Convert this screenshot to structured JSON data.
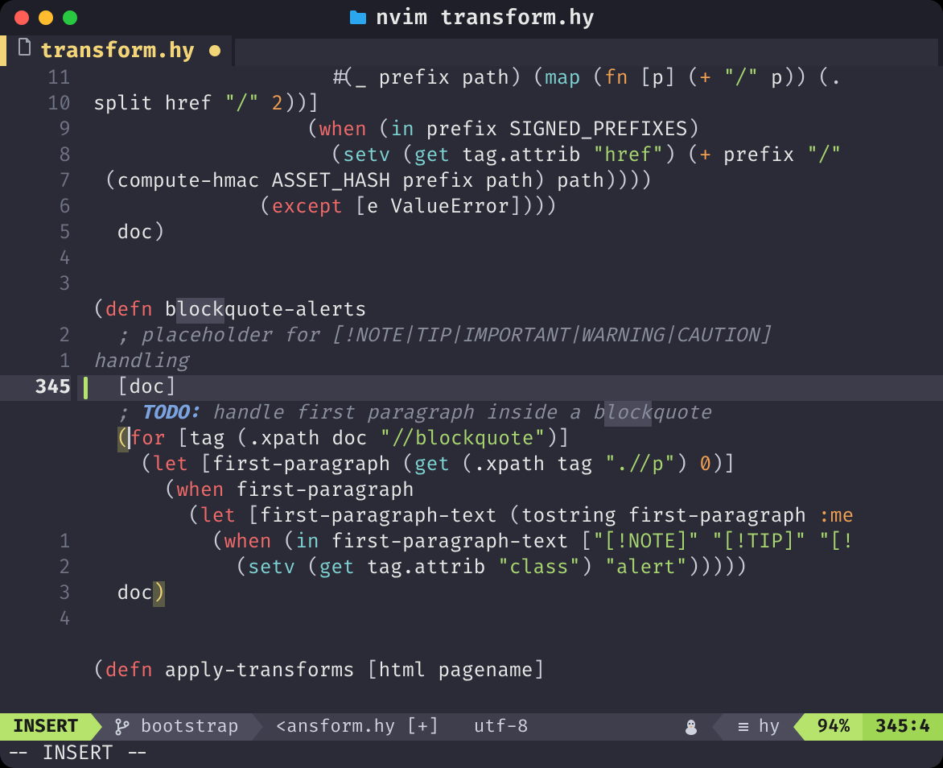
{
  "window": {
    "title": "nvim transform.hy"
  },
  "tab": {
    "filename": "transform.hy",
    "modified": true
  },
  "gutter": {
    "relative_numbers": [
      "11",
      "10",
      "9",
      "8",
      "7",
      "6",
      "5",
      "4",
      "3",
      "",
      "2",
      "1",
      "345",
      "",
      "",
      "",
      "",
      "",
      "1",
      "2",
      "3",
      "4"
    ],
    "current_line_index": 12
  },
  "code": {
    "lines": [
      [
        {
          "indent": "                    "
        },
        {
          "c": "pn",
          "t": "#("
        },
        {
          "c": "id",
          "t": "_ prefix path"
        },
        {
          "c": "pn",
          "t": ") ("
        },
        {
          "c": "fn",
          "t": "map"
        },
        {
          "c": "pn",
          "t": " ("
        },
        {
          "c": "op",
          "t": "fn"
        },
        {
          "c": "pn",
          "t": " ["
        },
        {
          "c": "id",
          "t": "p"
        },
        {
          "c": "pn",
          "t": "] ("
        },
        {
          "c": "op",
          "t": "+"
        },
        {
          "c": "pn",
          "t": " "
        },
        {
          "c": "st",
          "t": "\"/\""
        },
        {
          "c": "pn",
          "t": " "
        },
        {
          "c": "id",
          "t": "p"
        },
        {
          "c": "pn",
          "t": ")) (."
        }
      ],
      [
        {
          "c": "id",
          "t": "split href "
        },
        {
          "c": "st",
          "t": "\"/\""
        },
        {
          "c": "pn",
          "t": " "
        },
        {
          "c": "nu",
          "t": "2"
        },
        {
          "c": "pn",
          "t": "))]"
        }
      ],
      [
        {
          "indent": "                  "
        },
        {
          "c": "pn",
          "t": "("
        },
        {
          "c": "kw",
          "t": "when"
        },
        {
          "c": "pn",
          "t": " ("
        },
        {
          "c": "fn",
          "t": "in"
        },
        {
          "c": "pn",
          "t": " "
        },
        {
          "c": "id",
          "t": "prefix SIGNED_PREFIXES"
        },
        {
          "c": "pn",
          "t": ")"
        }
      ],
      [
        {
          "indent": "                    "
        },
        {
          "c": "pn",
          "t": "("
        },
        {
          "c": "fn",
          "t": "setv"
        },
        {
          "c": "pn",
          "t": " ("
        },
        {
          "c": "fn",
          "t": "get"
        },
        {
          "c": "pn",
          "t": " "
        },
        {
          "c": "id",
          "t": "tag.attrib "
        },
        {
          "c": "st",
          "t": "\"href\""
        },
        {
          "c": "pn",
          "t": ") ("
        },
        {
          "c": "op",
          "t": "+"
        },
        {
          "c": "pn",
          "t": " "
        },
        {
          "c": "id",
          "t": "prefix "
        },
        {
          "c": "st",
          "t": "\"/\""
        }
      ],
      [
        {
          "c": "pn",
          "t": " ("
        },
        {
          "c": "id",
          "t": "compute-hmac ASSET_HASH prefix path"
        },
        {
          "c": "pn",
          "t": ") "
        },
        {
          "c": "id",
          "t": "path"
        },
        {
          "c": "pn",
          "t": "))))"
        }
      ],
      [
        {
          "indent": "              "
        },
        {
          "c": "pn",
          "t": "("
        },
        {
          "c": "kw",
          "t": "except"
        },
        {
          "c": "pn",
          "t": " ["
        },
        {
          "c": "id",
          "t": "e ValueError"
        },
        {
          "c": "pn",
          "t": "])))"
        }
      ],
      [
        {
          "indent": "  "
        },
        {
          "c": "id",
          "t": "doc"
        },
        {
          "c": "pn",
          "t": ")"
        }
      ],
      [],
      [],
      [
        {
          "c": "pn",
          "t": "("
        },
        {
          "c": "kw",
          "t": "defn"
        },
        {
          "c": "pn",
          "t": " "
        },
        {
          "c": "id",
          "t": "b"
        },
        {
          "c": "id hl",
          "t": "lock"
        },
        {
          "c": "id",
          "t": "quote-alerts"
        }
      ],
      [
        {
          "indent": "  "
        },
        {
          "c": "cm",
          "t": "; placeholder for [!NOTE|TIP|IMPORTANT|WARNING|CAUTION] "
        }
      ],
      [
        {
          "c": "cm",
          "t": "handling"
        }
      ],
      [
        {
          "indent": "  "
        },
        {
          "c": "pn",
          "t": "["
        },
        {
          "c": "id",
          "t": "doc"
        },
        {
          "c": "pn",
          "t": "]"
        }
      ],
      [
        {
          "indent": "  "
        },
        {
          "c": "cm",
          "t": "; "
        },
        {
          "c": "td",
          "t": "TODO:"
        },
        {
          "c": "cm",
          "t": " handle first paragraph inside a b"
        },
        {
          "c": "cm hl",
          "t": "lock"
        },
        {
          "c": "cm",
          "t": "quote"
        }
      ],
      [
        {
          "indent": "  "
        },
        {
          "c": "mp",
          "t": "("
        },
        {
          "cursor": true
        },
        {
          "c": "kw",
          "t": "for"
        },
        {
          "c": "pn",
          "t": " ["
        },
        {
          "c": "id",
          "t": "tag "
        },
        {
          "c": "pn",
          "t": "("
        },
        {
          "c": "id",
          "t": ".xpath doc "
        },
        {
          "c": "st",
          "t": "\"//blockquote\""
        },
        {
          "c": "pn",
          "t": ")]"
        }
      ],
      [
        {
          "indent": "    "
        },
        {
          "c": "pn",
          "t": "("
        },
        {
          "c": "kw",
          "t": "let"
        },
        {
          "c": "pn",
          "t": " ["
        },
        {
          "c": "id",
          "t": "first-paragraph "
        },
        {
          "c": "pn",
          "t": "("
        },
        {
          "c": "fn",
          "t": "get"
        },
        {
          "c": "pn",
          "t": " ("
        },
        {
          "c": "id",
          "t": ".xpath tag "
        },
        {
          "c": "st",
          "t": "\".//p\""
        },
        {
          "c": "pn",
          "t": ") "
        },
        {
          "c": "nu",
          "t": "0"
        },
        {
          "c": "pn",
          "t": ")]"
        }
      ],
      [
        {
          "indent": "      "
        },
        {
          "c": "pn",
          "t": "("
        },
        {
          "c": "kw",
          "t": "when"
        },
        {
          "c": "pn",
          "t": " "
        },
        {
          "c": "id",
          "t": "first-paragraph"
        }
      ],
      [
        {
          "indent": "        "
        },
        {
          "c": "pn",
          "t": "("
        },
        {
          "c": "kw",
          "t": "let"
        },
        {
          "c": "pn",
          "t": " ["
        },
        {
          "c": "id",
          "t": "first-paragraph-text "
        },
        {
          "c": "pn",
          "t": "("
        },
        {
          "c": "id",
          "t": "tostring first-paragraph "
        },
        {
          "c": "op",
          "t": ":me"
        }
      ],
      [
        {
          "indent": "          "
        },
        {
          "c": "pn",
          "t": "("
        },
        {
          "c": "kw",
          "t": "when"
        },
        {
          "c": "pn",
          "t": " ("
        },
        {
          "c": "fn",
          "t": "in"
        },
        {
          "c": "pn",
          "t": " "
        },
        {
          "c": "id",
          "t": "first-paragraph-text "
        },
        {
          "c": "pn",
          "t": "["
        },
        {
          "c": "st",
          "t": "\"[!NOTE]\""
        },
        {
          "c": "pn",
          "t": " "
        },
        {
          "c": "st",
          "t": "\"[!TIP]\""
        },
        {
          "c": "pn",
          "t": " "
        },
        {
          "c": "st",
          "t": "\"[!"
        }
      ],
      [
        {
          "indent": "            "
        },
        {
          "c": "pn",
          "t": "("
        },
        {
          "c": "fn",
          "t": "setv"
        },
        {
          "c": "pn",
          "t": " ("
        },
        {
          "c": "fn",
          "t": "get"
        },
        {
          "c": "pn",
          "t": " "
        },
        {
          "c": "id",
          "t": "tag.attrib "
        },
        {
          "c": "st",
          "t": "\"class\""
        },
        {
          "c": "pn",
          "t": ") "
        },
        {
          "c": "st",
          "t": "\"alert\""
        },
        {
          "c": "pn",
          "t": ")))))"
        }
      ],
      [
        {
          "indent": "  "
        },
        {
          "c": "id",
          "t": "doc"
        },
        {
          "c": "mp",
          "t": ")"
        }
      ],
      [],
      [],
      [
        {
          "c": "pn",
          "t": "("
        },
        {
          "c": "kw",
          "t": "defn"
        },
        {
          "c": "pn",
          "t": " "
        },
        {
          "c": "id",
          "t": "apply-transforms "
        },
        {
          "c": "pn",
          "t": "["
        },
        {
          "c": "id",
          "t": "html pagename"
        },
        {
          "c": "pn",
          "t": "]"
        }
      ]
    ]
  },
  "statusline": {
    "mode": "INSERT",
    "branch": "bootstrap",
    "file": "<ansform.hy [+]",
    "encoding": "utf-8",
    "filetype": "hy",
    "percent": "94%",
    "position": "345:4"
  },
  "cmdline": "-- INSERT --"
}
